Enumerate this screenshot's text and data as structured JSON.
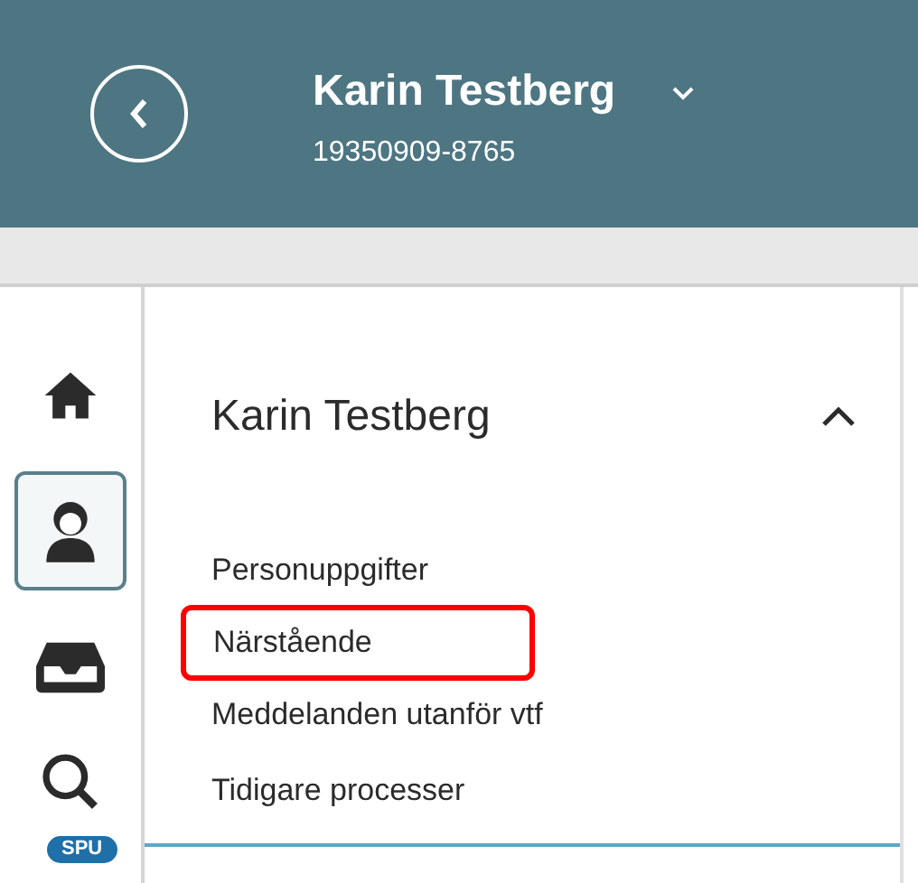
{
  "header": {
    "name": "Karin Testberg",
    "person_id": "19350909-8765"
  },
  "rail": [
    {
      "kind": "home",
      "selected": false
    },
    {
      "kind": "person",
      "selected": true
    },
    {
      "kind": "inbox",
      "selected": false
    },
    {
      "kind": "search",
      "selected": false
    }
  ],
  "rail_badge": "SPU",
  "panel": {
    "title": "Karin Testberg",
    "expanded": true,
    "links": [
      {
        "label": "Personuppgifter",
        "highlighted": false
      },
      {
        "label": "Närstående",
        "highlighted": true
      },
      {
        "label": "Meddelanden utanför vtf",
        "highlighted": false
      },
      {
        "label": "Tidigare processer",
        "highlighted": false
      }
    ]
  }
}
